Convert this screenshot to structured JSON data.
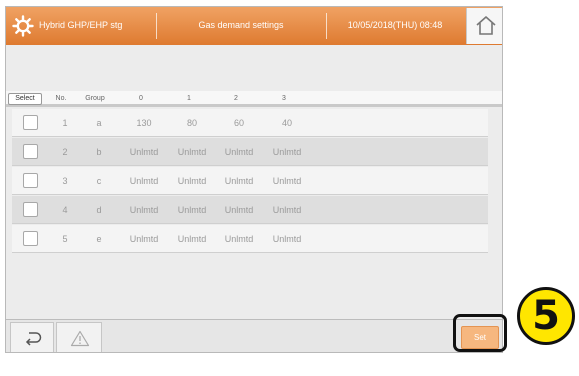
{
  "header": {
    "app_title": "Hybrid GHP/EHP stg",
    "screen_title": "Gas demand settings",
    "datetime": "10/05/2018(THU) 08:48",
    "home_icon": "home-icon",
    "app_icon": "sun-gear-icon",
    "accent_color": "#e08a45"
  },
  "table": {
    "select_label": "Select",
    "columns": [
      "No.",
      "Group",
      "0",
      "1",
      "2",
      "3"
    ],
    "rows": [
      {
        "no": "1",
        "group": "a",
        "c0": "130",
        "c1": "80",
        "c2": "60",
        "c3": "40",
        "checked": false
      },
      {
        "no": "2",
        "group": "b",
        "c0": "Unlmtd",
        "c1": "Unlmtd",
        "c2": "Unlmtd",
        "c3": "Unlmtd",
        "checked": false
      },
      {
        "no": "3",
        "group": "c",
        "c0": "Unlmtd",
        "c1": "Unlmtd",
        "c2": "Unlmtd",
        "c3": "Unlmtd",
        "checked": false
      },
      {
        "no": "4",
        "group": "d",
        "c0": "Unlmtd",
        "c1": "Unlmtd",
        "c2": "Unlmtd",
        "c3": "Unlmtd",
        "checked": false
      },
      {
        "no": "5",
        "group": "e",
        "c0": "Unlmtd",
        "c1": "Unlmtd",
        "c2": "Unlmtd",
        "c3": "Unlmtd",
        "checked": false
      }
    ]
  },
  "footer": {
    "back_icon": "return-arrow-icon",
    "warning_icon": "warning-icon",
    "set_label": "Set"
  },
  "callout": {
    "step_number": "5",
    "badge_color": "#ffe600"
  }
}
